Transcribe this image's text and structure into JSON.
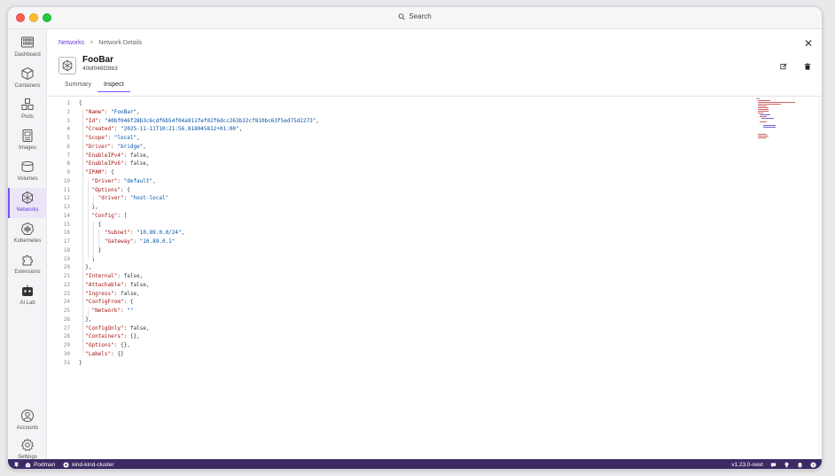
{
  "window": {
    "search_label": "Search"
  },
  "sidebar": {
    "items": [
      {
        "label": "Dashboard"
      },
      {
        "label": "Containers"
      },
      {
        "label": "Pods"
      },
      {
        "label": "Images"
      },
      {
        "label": "Volumes"
      },
      {
        "label": "Networks"
      },
      {
        "label": "Kubernetes"
      },
      {
        "label": "Extensions"
      },
      {
        "label": "AI Lab"
      }
    ],
    "bottom": [
      {
        "label": "Accounts"
      },
      {
        "label": "Settings"
      }
    ]
  },
  "breadcrumb": {
    "parent": "Networks",
    "separator": ">",
    "current": "Network Details"
  },
  "header": {
    "name": "FooBar",
    "id": "40bf046f28b3"
  },
  "tabs": [
    {
      "label": "Summary"
    },
    {
      "label": "Inspect"
    }
  ],
  "editor": {
    "lines": [
      {
        "n": "1",
        "t": "{"
      },
      {
        "n": "2",
        "t": "  \"Name\": \"FooBar\","
      },
      {
        "n": "3",
        "t": "  \"Id\": \"40bf046f28b3c6cdf6b54f04a911fef02f6dcc263b32cf810bc63f5ed75d2273\","
      },
      {
        "n": "4",
        "t": "  \"Created\": \"2025-11-11T10:21:56.818045812+01:00\","
      },
      {
        "n": "5",
        "t": "  \"Scope\": \"local\","
      },
      {
        "n": "6",
        "t": "  \"Driver\": \"bridge\","
      },
      {
        "n": "7",
        "t": "  \"EnableIPv4\": false,"
      },
      {
        "n": "8",
        "t": "  \"EnableIPv6\": false,"
      },
      {
        "n": "9",
        "t": "  \"IPAM\": {"
      },
      {
        "n": "10",
        "t": "    \"Driver\": \"default\","
      },
      {
        "n": "11",
        "t": "    \"Options\": {"
      },
      {
        "n": "12",
        "t": "      \"driver\": \"host-local\""
      },
      {
        "n": "13",
        "t": "    },"
      },
      {
        "n": "14",
        "t": "    \"Config\": ["
      },
      {
        "n": "15",
        "t": "      {"
      },
      {
        "n": "16",
        "t": "        \"Subnet\": \"10.89.0.0/24\","
      },
      {
        "n": "17",
        "t": "        \"Gateway\": \"10.89.0.1\""
      },
      {
        "n": "18",
        "t": "      }"
      },
      {
        "n": "19",
        "t": "    ]"
      },
      {
        "n": "20",
        "t": "  },"
      },
      {
        "n": "21",
        "t": "  \"Internal\": false,"
      },
      {
        "n": "22",
        "t": "  \"Attachable\": false,"
      },
      {
        "n": "23",
        "t": "  \"Ingress\": false,"
      },
      {
        "n": "24",
        "t": "  \"ConfigFrom\": {"
      },
      {
        "n": "25",
        "t": "    \"Network\": \"\""
      },
      {
        "n": "26",
        "t": "  },"
      },
      {
        "n": "27",
        "t": "  \"ConfigOnly\": false,"
      },
      {
        "n": "28",
        "t": "  \"Containers\": {},"
      },
      {
        "n": "29",
        "t": "  \"Options\": {},"
      },
      {
        "n": "30",
        "t": "  \"Labels\": {}"
      },
      {
        "n": "31",
        "t": "}"
      }
    ]
  },
  "statusbar": {
    "engine": "Podman",
    "context": "kind-kind-cluster",
    "version": "v1.23.0-next"
  },
  "colors": {
    "accent": "#7c4dff",
    "statusbar": "#3b2a64",
    "json_key": "#a31515",
    "json_string": "#0451a5"
  }
}
